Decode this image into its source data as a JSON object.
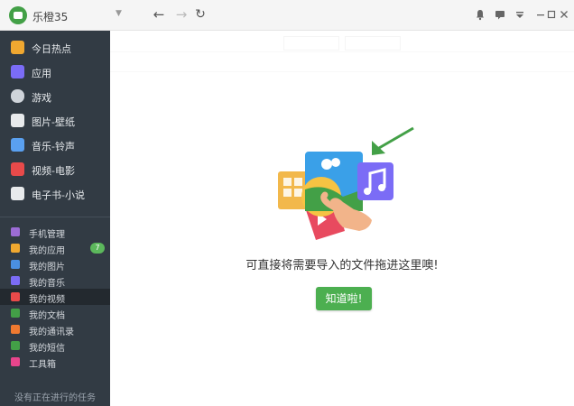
{
  "titlebar": {
    "app_name": "乐橙35",
    "dropdown_glyph": "▼",
    "back_glyph": "←",
    "forward_glyph": "→",
    "refresh_glyph": "↻"
  },
  "sidebar": {
    "main_items": [
      {
        "label": "今日热点",
        "icon": "hot-news-icon",
        "color": "#f0a830"
      },
      {
        "label": "应用",
        "icon": "apps-icon",
        "color": "#7b6cf6"
      },
      {
        "label": "游戏",
        "icon": "gamepad-icon",
        "color": "#cfd4da"
      },
      {
        "label": "图片-壁纸",
        "icon": "picture-icon",
        "color": "#e8eaec"
      },
      {
        "label": "音乐-铃声",
        "icon": "music-note-icon",
        "color": "#5aa0f0"
      },
      {
        "label": "视频-电影",
        "icon": "video-icon",
        "color": "#e84a4a"
      },
      {
        "label": "电子书-小说",
        "icon": "ebook-icon",
        "color": "#e8eaec"
      }
    ],
    "sub_items": [
      {
        "label": "手机管理",
        "icon": "phone-manage-icon",
        "color": "#9c6cd6",
        "active": false
      },
      {
        "label": "我的应用",
        "icon": "my-apps-icon",
        "color": "#f0a830",
        "active": false,
        "badge": "7"
      },
      {
        "label": "我的图片",
        "icon": "my-pictures-icon",
        "color": "#4a90e2",
        "active": false
      },
      {
        "label": "我的音乐",
        "icon": "my-music-icon",
        "color": "#7b6cf6",
        "active": false
      },
      {
        "label": "我的视频",
        "icon": "my-video-icon",
        "color": "#e84a4a",
        "active": true
      },
      {
        "label": "我的文档",
        "icon": "my-docs-icon",
        "color": "#43a047",
        "active": false
      },
      {
        "label": "我的通讯录",
        "icon": "contacts-icon",
        "color": "#f07a30",
        "active": false
      },
      {
        "label": "我的短信",
        "icon": "sms-icon",
        "color": "#43a047",
        "active": false
      },
      {
        "label": "工具箱",
        "icon": "toolbox-icon",
        "color": "#e8458c",
        "active": false
      }
    ],
    "task_status": "没有正在进行的任务"
  },
  "dialog": {
    "hint": "可直接将需要导入的文件拖进这里噢!",
    "confirm_label": "知道啦!"
  },
  "colors": {
    "sidebar_bg": "#323b44",
    "accent_green": "#4caf50"
  }
}
